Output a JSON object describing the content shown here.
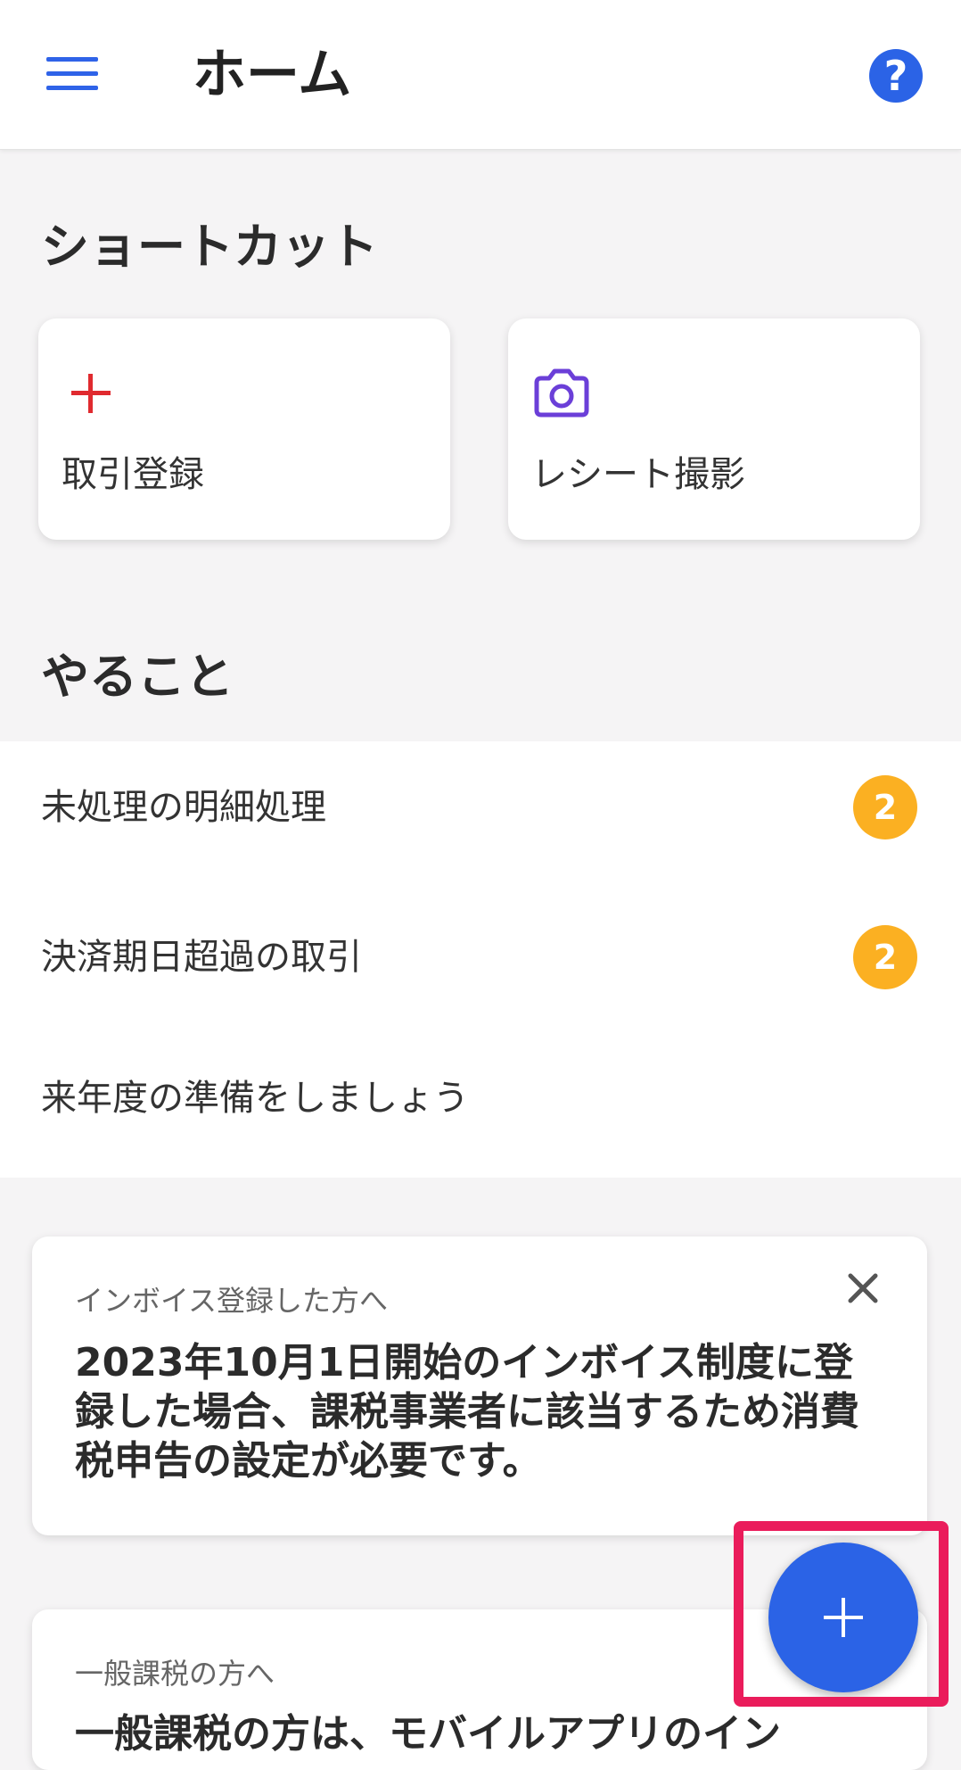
{
  "header": {
    "title": "ホーム"
  },
  "icons": {
    "menu": "hamburger-menu-icon",
    "help": "question-mark-icon",
    "help_glyph": "?",
    "close": "close-icon",
    "fab": "plus-icon"
  },
  "shortcuts": {
    "title": "ショートカット",
    "items": [
      {
        "label": "取引登録",
        "icon": "plus-icon"
      },
      {
        "label": "レシート撮影",
        "icon": "camera-icon"
      }
    ]
  },
  "todo": {
    "title": "やること",
    "items": [
      {
        "label": "未処理の明細処理",
        "badge": "2"
      },
      {
        "label": "決済期日超過の取引",
        "badge": "2"
      },
      {
        "label": "来年度の準備をしましょう"
      }
    ]
  },
  "notices": [
    {
      "subtitle": "インボイス登録した方へ",
      "body": "2023年10月1日開始のインボイス制度に登録した場合、課税事業者に該当するため消費税申告の設定が必要です。"
    },
    {
      "subtitle": "一般課税の方へ",
      "body": "一般課税の方は、モバイルアプリのイン"
    }
  ],
  "colors": {
    "accent": "#2b63e6",
    "badge": "#fbb022",
    "plus": "#e02a2f",
    "camera": "#6b3fd8",
    "highlight": "#ea1c5b"
  }
}
